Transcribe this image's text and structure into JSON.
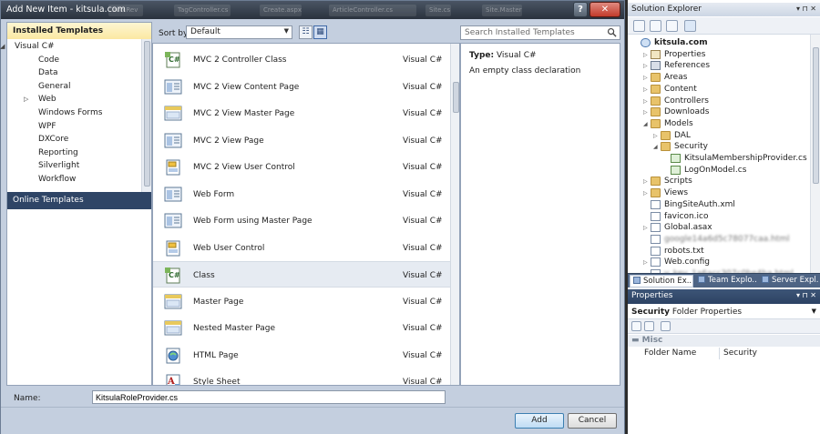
{
  "dialog": {
    "title": "Add New Item - kitsula.com",
    "help_label": "?",
    "close_label": "✕",
    "ghost_tabs": [
      "Start Page",
      "Info.Rev",
      "TagController.cs",
      "Create.aspx",
      "ArticleController.cs",
      "Site.cs",
      "Site.Master"
    ],
    "left_pane": {
      "header": "Installed Templates",
      "tree": [
        {
          "label": "Visual C#",
          "level": 0,
          "expander": "◢"
        },
        {
          "label": "Code",
          "level": 1,
          "expander": ""
        },
        {
          "label": "Data",
          "level": 1,
          "expander": ""
        },
        {
          "label": "General",
          "level": 1,
          "expander": ""
        },
        {
          "label": "Web",
          "level": 1,
          "expander": "▷"
        },
        {
          "label": "Windows Forms",
          "level": 1,
          "expander": ""
        },
        {
          "label": "WPF",
          "level": 1,
          "expander": ""
        },
        {
          "label": "DXCore",
          "level": 1,
          "expander": ""
        },
        {
          "label": "Reporting",
          "level": 1,
          "expander": ""
        },
        {
          "label": "Silverlight",
          "level": 1,
          "expander": ""
        },
        {
          "label": "Workflow",
          "level": 1,
          "expander": ""
        }
      ],
      "online": "Online Templates"
    },
    "sort": {
      "label": "Sort by:",
      "value": "Default",
      "arrow": "▼"
    },
    "view_buttons": {
      "small_icon": "☷",
      "medium_icon": "▦"
    },
    "search": {
      "placeholder": "Search Installed Templates"
    },
    "items": [
      {
        "name": "MVC 2 Controller Class",
        "lang": "Visual C#",
        "icon": "cs"
      },
      {
        "name": "MVC 2 View Content Page",
        "lang": "Visual C#",
        "icon": "page"
      },
      {
        "name": "MVC 2 View Master Page",
        "lang": "Visual C#",
        "icon": "master"
      },
      {
        "name": "MVC 2 View Page",
        "lang": "Visual C#",
        "icon": "page"
      },
      {
        "name": "MVC 2 View User Control",
        "lang": "Visual C#",
        "icon": "control"
      },
      {
        "name": "Web Form",
        "lang": "Visual C#",
        "icon": "page"
      },
      {
        "name": "Web Form using Master Page",
        "lang": "Visual C#",
        "icon": "page"
      },
      {
        "name": "Web User Control",
        "lang": "Visual C#",
        "icon": "control"
      },
      {
        "name": "Class",
        "lang": "Visual C#",
        "icon": "cs"
      },
      {
        "name": "Master Page",
        "lang": "Visual C#",
        "icon": "master"
      },
      {
        "name": "Nested Master Page",
        "lang": "Visual C#",
        "icon": "master"
      },
      {
        "name": "HTML Page",
        "lang": "Visual C#",
        "icon": "html"
      },
      {
        "name": "Style Sheet",
        "lang": "Visual C#",
        "icon": "css"
      }
    ],
    "selected_item": 8,
    "details": {
      "type_label": "Type:",
      "type_value": "Visual C#",
      "description": "An empty class declaration"
    },
    "name_field": {
      "label": "Name:",
      "value": "KitsulaRoleProvider.cs"
    },
    "buttons": {
      "add": "Add",
      "cancel": "Cancel"
    }
  },
  "solution_explorer": {
    "title": "Solution Explorer",
    "title_buttons": "▾ ⊓ ✕",
    "tree": [
      {
        "label": "kitsula.com",
        "depth": 0,
        "expander": "",
        "icon": "web",
        "bold": true
      },
      {
        "label": "Properties",
        "depth": 1,
        "expander": "▷",
        "icon": "props"
      },
      {
        "label": "References",
        "depth": 1,
        "expander": "▷",
        "icon": "refs"
      },
      {
        "label": "Areas",
        "depth": 1,
        "expander": "▷",
        "icon": "folder"
      },
      {
        "label": "Content",
        "depth": 1,
        "expander": "▷",
        "icon": "folder"
      },
      {
        "label": "Controllers",
        "depth": 1,
        "expander": "▷",
        "icon": "folder"
      },
      {
        "label": "Downloads",
        "depth": 1,
        "expander": "▷",
        "icon": "folder"
      },
      {
        "label": "Models",
        "depth": 1,
        "expander": "◢",
        "icon": "folder"
      },
      {
        "label": "DAL",
        "depth": 2,
        "expander": "▷",
        "icon": "folder"
      },
      {
        "label": "Security",
        "depth": 2,
        "expander": "◢",
        "icon": "folder"
      },
      {
        "label": "KitsulaMembershipProvider.cs",
        "depth": 3,
        "expander": "",
        "icon": "cs"
      },
      {
        "label": "LogOnModel.cs",
        "depth": 3,
        "expander": "",
        "icon": "cs"
      },
      {
        "label": "Scripts",
        "depth": 1,
        "expander": "▷",
        "icon": "folder"
      },
      {
        "label": "Views",
        "depth": 1,
        "expander": "▷",
        "icon": "folder"
      },
      {
        "label": "BingSiteAuth.xml",
        "depth": 1,
        "expander": "",
        "icon": "file"
      },
      {
        "label": "favicon.ico",
        "depth": 1,
        "expander": "",
        "icon": "file"
      },
      {
        "label": "Global.asax",
        "depth": 1,
        "expander": "▷",
        "icon": "file"
      },
      {
        "label": "google14a6d5c78077caa.html",
        "depth": 1,
        "expander": "",
        "icon": "file",
        "blurred": true
      },
      {
        "label": "robots.txt",
        "depth": 1,
        "expander": "",
        "icon": "file"
      },
      {
        "label": "Web.config",
        "depth": 1,
        "expander": "▷",
        "icon": "file"
      },
      {
        "label": "y_key_1a6acc307c0be4ba.html",
        "depth": 1,
        "expander": "",
        "icon": "file",
        "blurred": true
      }
    ],
    "tabs": [
      "Solution Ex...",
      "Team Explo...",
      "Server Expl..."
    ]
  },
  "properties": {
    "title": "Properties",
    "title_buttons": "▾ ⊓ ✕",
    "object_name": "Security",
    "object_type": "Folder Properties",
    "dropdown_arrow": "▼",
    "category_toggle": "▬",
    "category": "Misc",
    "rows": [
      {
        "key": "Folder Name",
        "value": "Security"
      }
    ]
  }
}
